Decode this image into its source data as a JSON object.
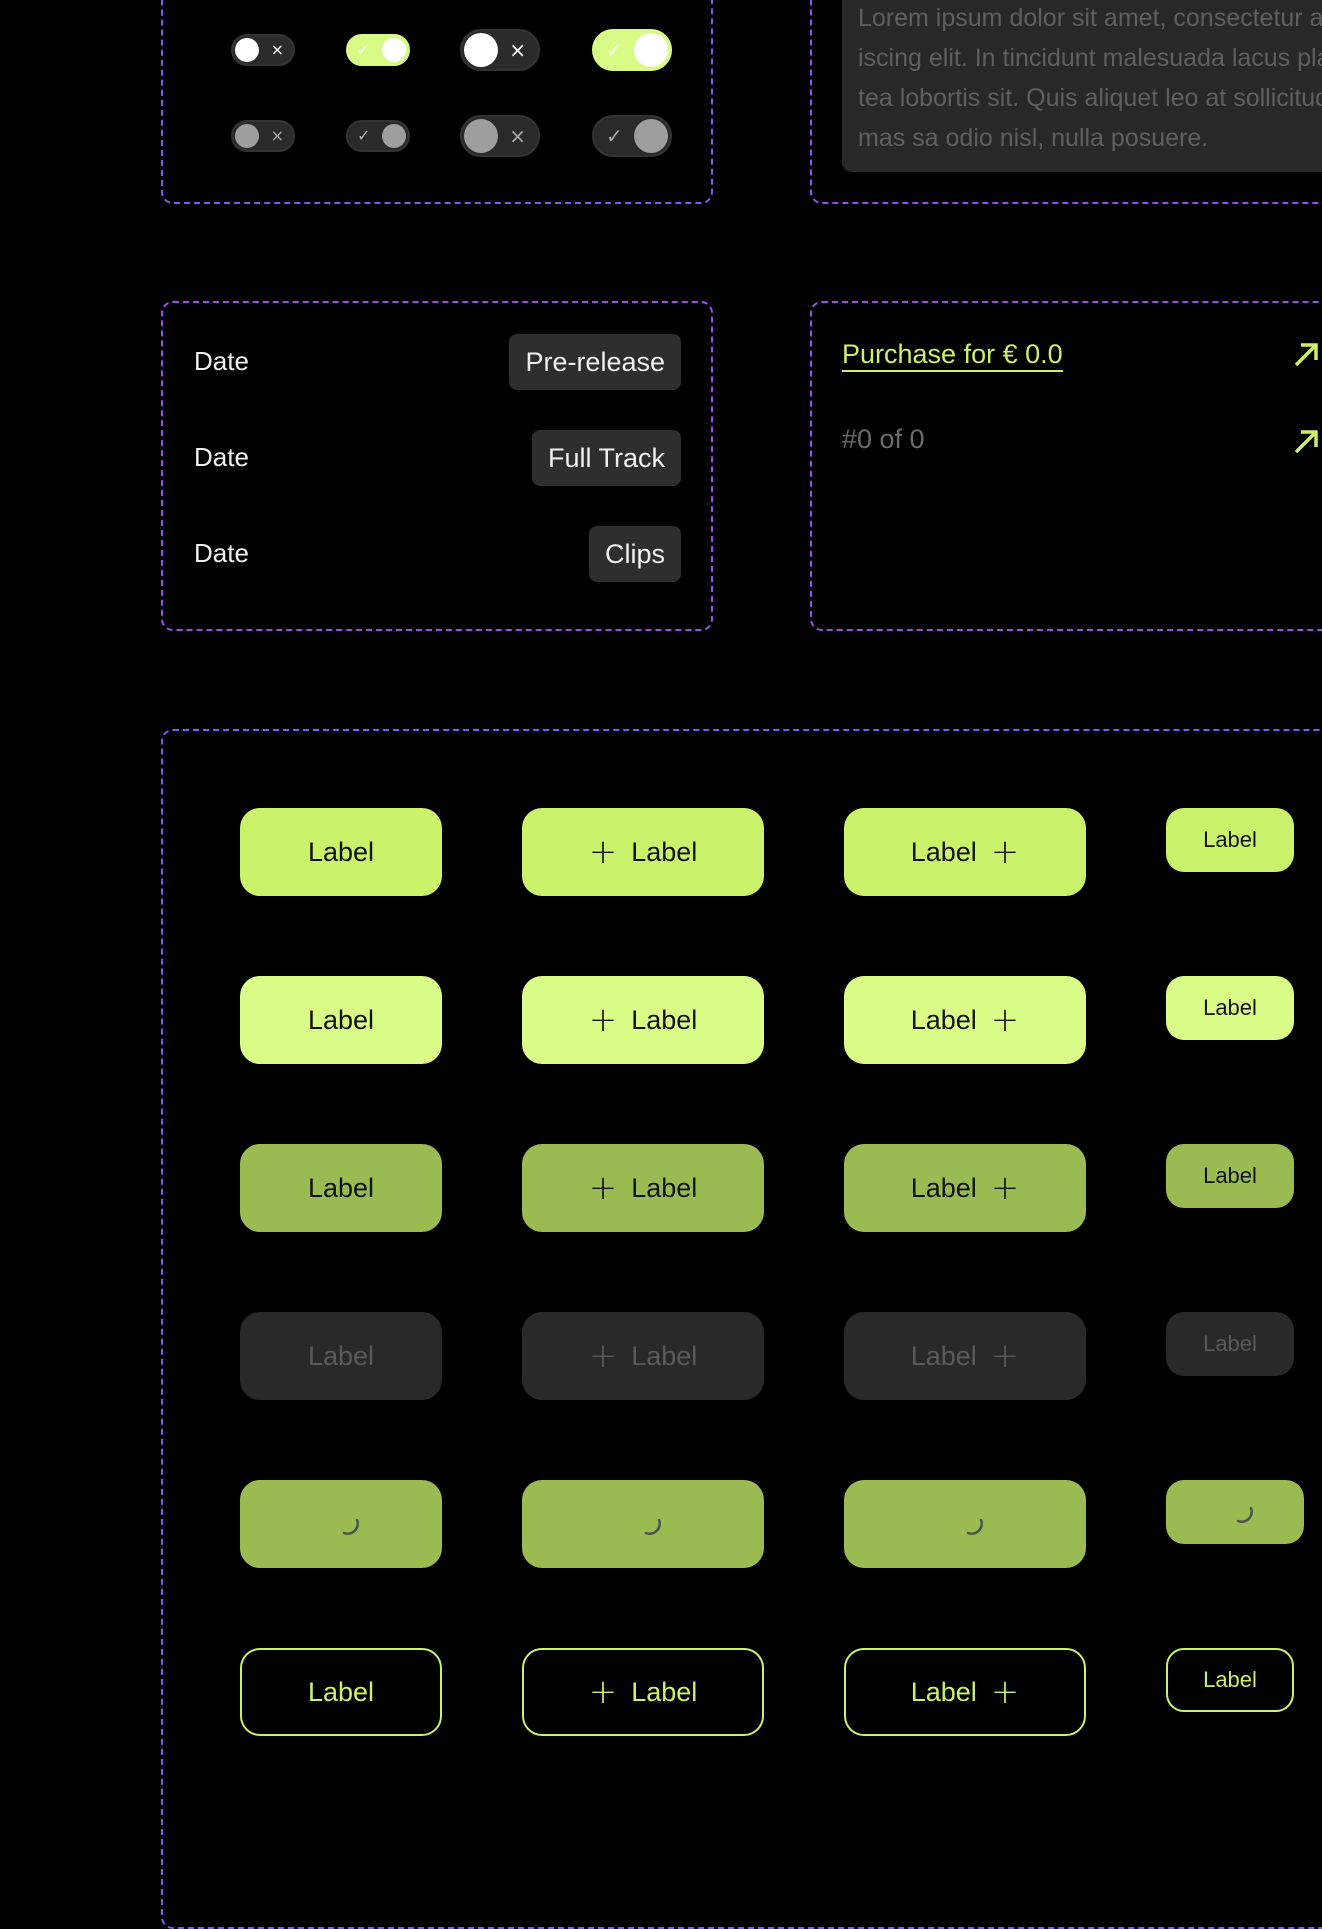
{
  "colors": {
    "accent": "#cbf26b",
    "accent_hover": "#d9fd87",
    "accent_pressed": "#99bb52",
    "disabled_bg": "#292929",
    "frame_dash": "#7b5cf0",
    "frame_dash_alt": "#9b4df5",
    "surface": "#2e2e2e"
  },
  "toggles": [
    {
      "size": "small",
      "state": "off",
      "enabled": true,
      "glyph": "×"
    },
    {
      "size": "small",
      "state": "on",
      "enabled": true,
      "glyph": "✓"
    },
    {
      "size": "large",
      "state": "off",
      "enabled": true,
      "glyph": "×"
    },
    {
      "size": "large",
      "state": "on",
      "enabled": true,
      "glyph": "✓"
    },
    {
      "size": "small",
      "state": "off",
      "enabled": false,
      "glyph": "×"
    },
    {
      "size": "small",
      "state": "on",
      "enabled": false,
      "glyph": "✓"
    },
    {
      "size": "large",
      "state": "off",
      "enabled": false,
      "glyph": "×"
    },
    {
      "size": "large",
      "state": "on",
      "enabled": false,
      "glyph": "✓"
    }
  ],
  "textarea": {
    "lines": [
      "Lorem ipsum dolor sit amet, consectetur adip-",
      "iscing elit. In tincidunt malesuada lacus pla-",
      "tea lobortis sit. Quis aliquet leo at sollicitudin",
      "mas sa odio nisl, nulla posuere."
    ]
  },
  "release_rows": [
    {
      "label": "Date",
      "tag": "Pre-release"
    },
    {
      "label": "Date",
      "tag": "Full Track"
    },
    {
      "label": "Date",
      "tag": "Clips"
    }
  ],
  "purchase": {
    "link_label": "Purchase for € 0.0",
    "link_icon": "arrow-up-right-icon",
    "count_label": "#0 of 0",
    "count_icon": "arrow-up-right-icon"
  },
  "buttons": {
    "label": "Label",
    "plus_glyph": "+",
    "rows": [
      "primary",
      "hover",
      "pressed",
      "disabled",
      "loading",
      "outline"
    ],
    "columns": [
      "text",
      "icon-left",
      "icon-right",
      "small"
    ]
  }
}
